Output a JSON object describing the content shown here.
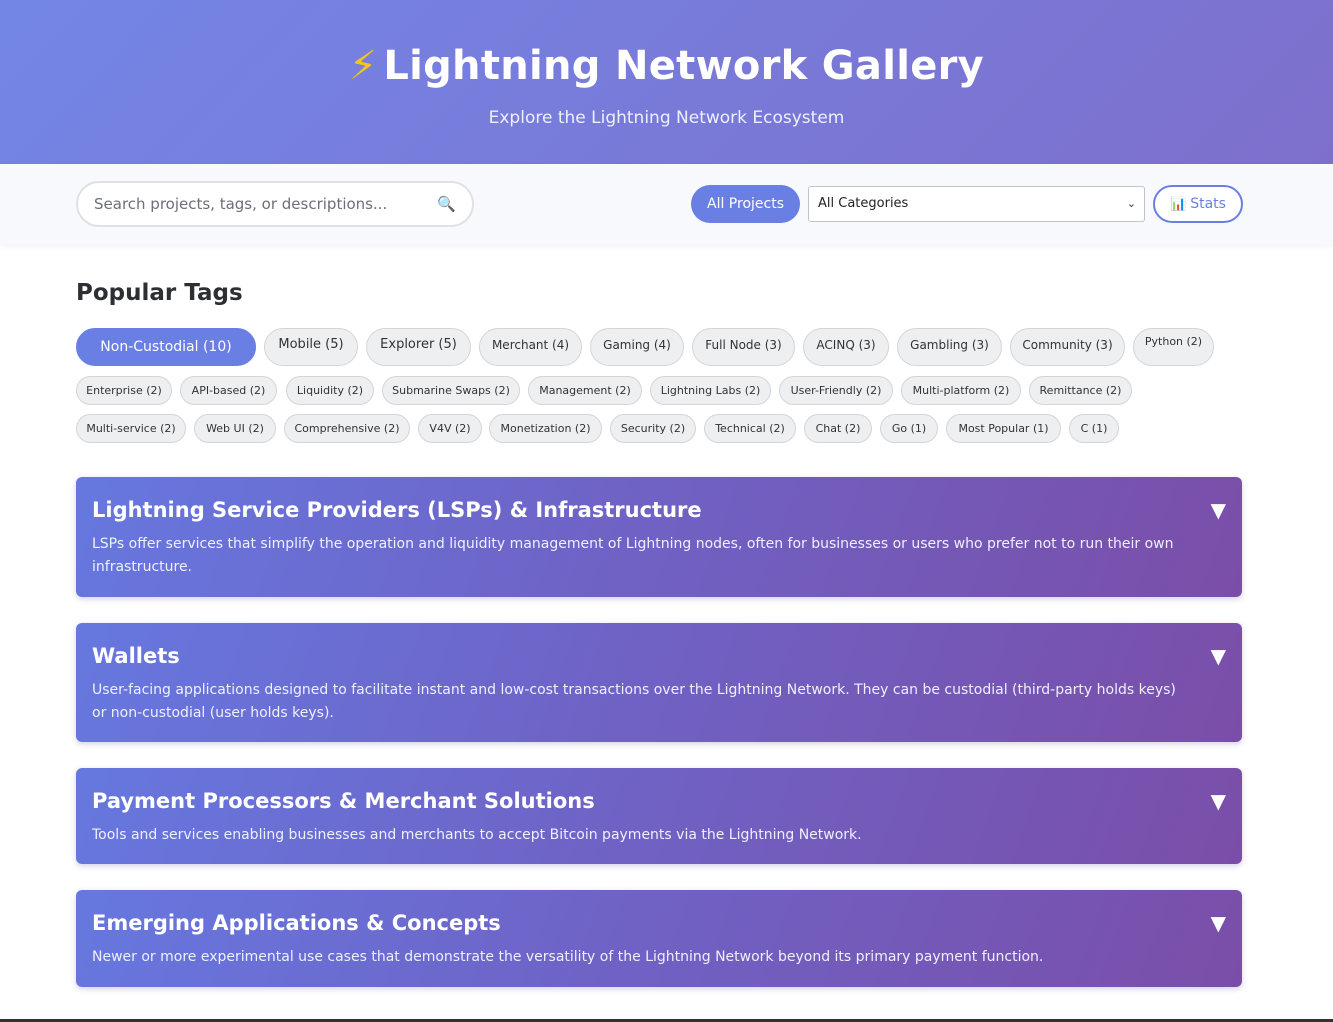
{
  "header": {
    "bolt": "⚡",
    "title": "Lightning Network Gallery",
    "subtitle": "Explore the Lightning Network Ecosystem"
  },
  "toolbar": {
    "search_placeholder": "Search projects, tags, or descriptions...",
    "search_icon": "🔍",
    "all_projects_label": "All Projects",
    "category_select_value": "All Categories",
    "stats_icon": "📊",
    "stats_label": "Stats"
  },
  "tags": {
    "title": "Popular Tags",
    "items": [
      "Non-Custodial (10)",
      "Mobile (5)",
      "Explorer (5)",
      "Merchant (4)",
      "Gaming (4)",
      "Full Node (3)",
      "ACINQ (3)",
      "Gambling (3)",
      "Community (3)",
      "Python (2)",
      "Enterprise (2)",
      "API-based (2)",
      "Liquidity (2)",
      "Submarine Swaps (2)",
      "Management (2)",
      "Lightning Labs (2)",
      "User-Friendly (2)",
      "Multi-platform (2)",
      "Remittance (2)",
      "Multi-service (2)",
      "Web UI (2)",
      "Comprehensive (2)",
      "V4V (2)",
      "Monetization (2)",
      "Security (2)",
      "Technical (2)",
      "Chat (2)",
      "Go (1)",
      "Most Popular (1)",
      "C (1)"
    ]
  },
  "categories": [
    {
      "title": "Lightning Service Providers (LSPs) & Infrastructure",
      "description": "LSPs offer services that simplify the operation and liquidity management of Lightning nodes, often for businesses or users who prefer not to run their own infrastructure."
    },
    {
      "title": "Wallets",
      "description": "User-facing applications designed to facilitate instant and low-cost transactions over the Lightning Network. They can be custodial (third-party holds keys) or non-custodial (user holds keys)."
    },
    {
      "title": "Payment Processors & Merchant Solutions",
      "description": "Tools and services enabling businesses and merchants to accept Bitcoin payments via the Lightning Network."
    },
    {
      "title": "Emerging Applications & Concepts",
      "description": "Newer or more experimental use cases that demonstrate the versatility of the Lightning Network beyond its primary payment function."
    }
  ],
  "expand_arrow": "▼"
}
